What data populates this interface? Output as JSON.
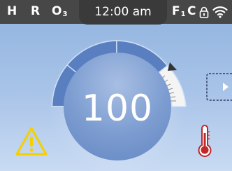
{
  "statusbar": {
    "left_indicators": [
      "H",
      "R",
      "O",
      "3"
    ],
    "time": "12:00 am",
    "right_indicators": {
      "f_label": "F",
      "f_sub": "1",
      "c_label": "C"
    }
  },
  "dial": {
    "value": "100",
    "segments_total": 4,
    "segments_active": 4
  },
  "icons": {
    "lock": "lock-icon",
    "wifi": "wifi-icon",
    "warning": "warning-icon",
    "thermometer": "thermometer-icon",
    "next": "play-right-icon"
  },
  "colors": {
    "topbar": "#474747",
    "background": "#a9c4e8",
    "arc_segment": "#5a7fc0",
    "arc_gauge": "#f4f4f4",
    "warning": "#f5d000",
    "thermometer": "#c0282a"
  }
}
